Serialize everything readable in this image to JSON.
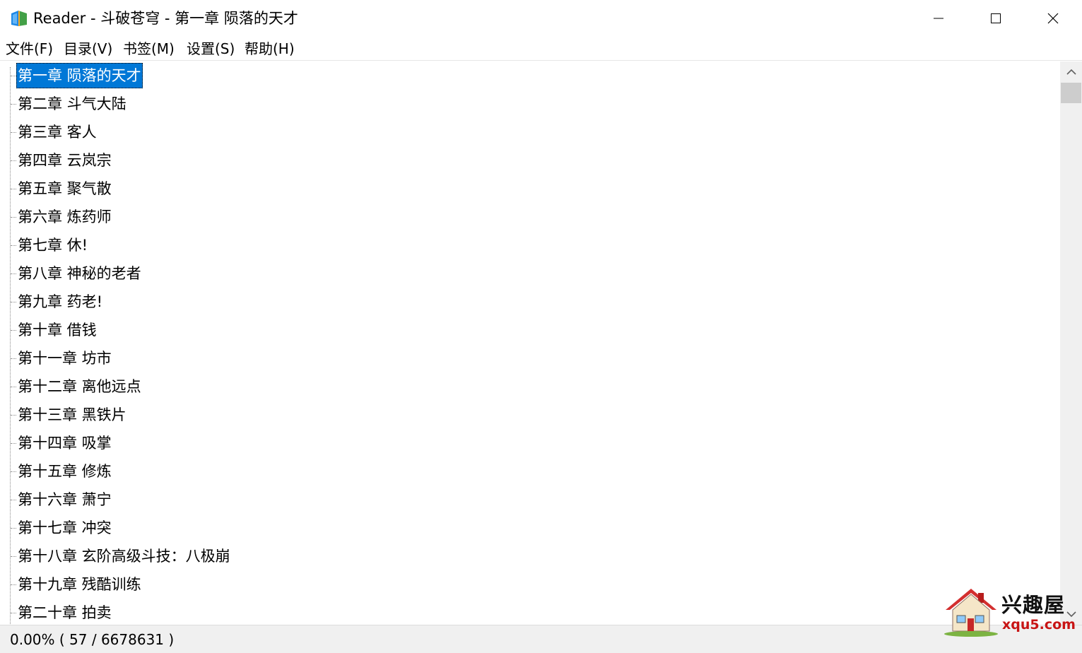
{
  "window": {
    "title": "Reader - 斗破苍穹 - 第一章 陨落的天才",
    "controls": {
      "minimize": "minimize",
      "maximize": "maximize",
      "close": "close"
    }
  },
  "menu": [
    {
      "label": "文件(F)"
    },
    {
      "label": "目录(V)"
    },
    {
      "label": "书签(M)"
    },
    {
      "label": "设置(S)"
    },
    {
      "label": "帮助(H)"
    }
  ],
  "chapters": [
    "第一章 陨落的天才",
    "第二章 斗气大陆",
    "第三章 客人",
    "第四章 云岚宗",
    "第五章 聚气散",
    "第六章 炼药师",
    "第七章 休!",
    "第八章 神秘的老者",
    "第九章 药老!",
    "第十章 借钱",
    "第十一章 坊市",
    "第十二章 离他远点",
    "第十三章 黑铁片",
    "第十四章 吸掌",
    "第十五章 修炼",
    "第十六章 萧宁",
    "第十七章 冲突",
    "第十八章 玄阶高级斗技：八极崩",
    "第十九章 残酷训练",
    "第二十章 拍卖"
  ],
  "selected_index": 0,
  "status": {
    "text": "0.00% ( 57 / 6678631 )",
    "percent": 0.0,
    "position": 57,
    "total": 6678631
  },
  "watermark": {
    "name": "兴趣屋",
    "url": "xqu5.com"
  },
  "colors": {
    "selection": "#0078d7",
    "scrollbar_track": "#f0f0f0",
    "scrollbar_thumb": "#cdcdcd",
    "watermark_url": "#c81414"
  },
  "icons": {
    "app": "book-icon",
    "scroll_up": "chevron-up-icon",
    "scroll_down": "chevron-down-icon"
  }
}
